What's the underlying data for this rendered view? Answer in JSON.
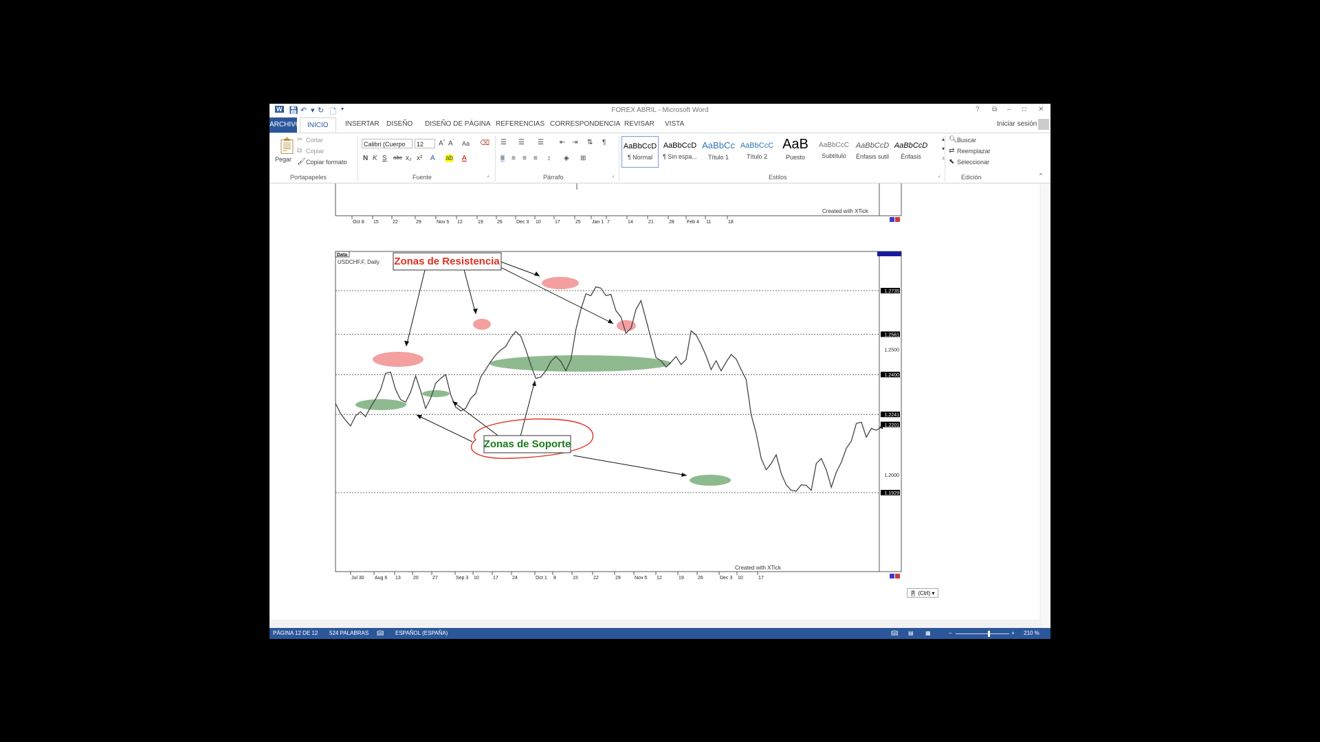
{
  "window": {
    "title": "FOREX ABRIL - Microsoft Word",
    "buttons": [
      "?",
      "⧉",
      "–",
      "□",
      "✕"
    ]
  },
  "tabs": {
    "items": [
      "ARCHIVO",
      "INICIO",
      "INSERTAR",
      "DISEÑO",
      "DISEÑO DE PÁGINA",
      "REFERENCIAS",
      "CORRESPONDENCIA",
      "REVISAR",
      "VISTA"
    ],
    "sign_in": "Iniciar sesión"
  },
  "ribbon": {
    "clipboard": {
      "paste": "Pegar",
      "cut": "Cortar",
      "copy": "Copiar",
      "format_painter": "Copiar formato",
      "label": "Portapapeles"
    },
    "font": {
      "name": "Calibri (Cuerpo",
      "size": "12",
      "change_case": "Aa",
      "label": "Fuente"
    },
    "paragraph": {
      "label": "Párrafo"
    },
    "styles": {
      "label": "Estilos",
      "items": [
        {
          "preview": "AaBbCcD",
          "name": "¶ Normal"
        },
        {
          "preview": "AaBbCcD",
          "name": "¶ Sin espa..."
        },
        {
          "preview": "AaBbCc",
          "name": "Título 1"
        },
        {
          "preview": "AaBbCcC",
          "name": "Título 2"
        },
        {
          "preview": "AaB",
          "name": "Puesto"
        },
        {
          "preview": "AaBbCcC",
          "name": "Subtítulo"
        },
        {
          "preview": "AaBbCcD",
          "name": "Énfasis sutil"
        },
        {
          "preview": "AaBbCcD",
          "name": "Énfasis"
        }
      ]
    },
    "editing": {
      "find": "Buscar",
      "replace": "Reemplazar",
      "select": "Seleccionar",
      "label": "Edición"
    }
  },
  "document": {
    "chart_top": {
      "watermark": "Created with XTick",
      "x_ticks": [
        "Oct 8",
        "15",
        "22",
        "29",
        "Nov 5",
        "12",
        "19",
        "26",
        "Dec 3",
        "10",
        "17",
        "25",
        "Jan 1",
        "7",
        "14",
        "21",
        "28",
        "Feb 4",
        "11",
        "18"
      ]
    },
    "paste_options": "(Ctrl)"
  },
  "chart_data": {
    "type": "line",
    "title": "USDCHF.F, Daily",
    "tab_label": "Data",
    "watermark": "Created with XTick",
    "x_ticks": [
      "Jul 30",
      "Aug 6",
      "13",
      "20",
      "27",
      "Sep 3",
      "10",
      "17",
      "24",
      "Oct 1",
      "8",
      "15",
      "22",
      "29",
      "Nov 5",
      "12",
      "19",
      "26",
      "Dec 3",
      "10",
      "17"
    ],
    "y_ticks": [
      "1.2735",
      "1.2561",
      "1.2500",
      "1.2400",
      "1.2241",
      "1.2201",
      "1.2000",
      "1.1929"
    ],
    "horizontal_levels": [
      1.2735,
      1.2561,
      1.24,
      1.2241,
      1.1929
    ],
    "ylim": [
      1.19,
      1.28
    ],
    "annotations": {
      "resistance": "Zonas de Resistencia",
      "support": "Zonas de Soporte"
    },
    "series": [
      {
        "values": [
          1.2285,
          1.2245,
          1.2218,
          1.2195,
          1.2235,
          1.2252,
          1.2232,
          1.227,
          1.2302,
          1.234,
          1.2405,
          1.241,
          1.234,
          1.23,
          1.229,
          1.233,
          1.2395,
          1.2335,
          1.2265,
          1.2305,
          1.2365,
          1.2385,
          1.24,
          1.232,
          1.227,
          1.2255,
          1.2265,
          1.2305,
          1.2325,
          1.239,
          1.242,
          1.2452,
          1.2478,
          1.2498,
          1.2512,
          1.2548,
          1.2572,
          1.2553,
          1.25,
          1.2438,
          1.2385,
          1.239,
          1.2415,
          1.2452,
          1.2472,
          1.2452,
          1.2415,
          1.246,
          1.258,
          1.266,
          1.2722,
          1.2715,
          1.275,
          1.2745,
          1.2715,
          1.272,
          1.2655,
          1.263,
          1.2565,
          1.2585,
          1.266,
          1.2695,
          1.262,
          1.2545,
          1.2468,
          1.2455,
          1.243,
          1.245,
          1.2472,
          1.244,
          1.246,
          1.2575,
          1.2558,
          1.252,
          1.2475,
          1.242,
          1.2455,
          1.2415,
          1.245,
          1.248,
          1.2462,
          1.242,
          1.238,
          1.224,
          1.2165,
          1.2065,
          1.202,
          1.2045,
          1.208,
          1.2005,
          1.196,
          1.1938,
          1.1935,
          1.196,
          1.1958,
          1.1938,
          1.2045,
          1.2065,
          1.202,
          1.195,
          1.201,
          1.205,
          1.2105,
          1.2135,
          1.2205,
          1.221,
          1.215,
          1.2185,
          1.2178,
          1.219
        ]
      }
    ]
  },
  "statusbar": {
    "page": "PÁGINA 12 DE 12",
    "words": "524 PALABRAS",
    "language": "ESPAÑOL (ESPAÑA)",
    "zoom": "210 %"
  }
}
